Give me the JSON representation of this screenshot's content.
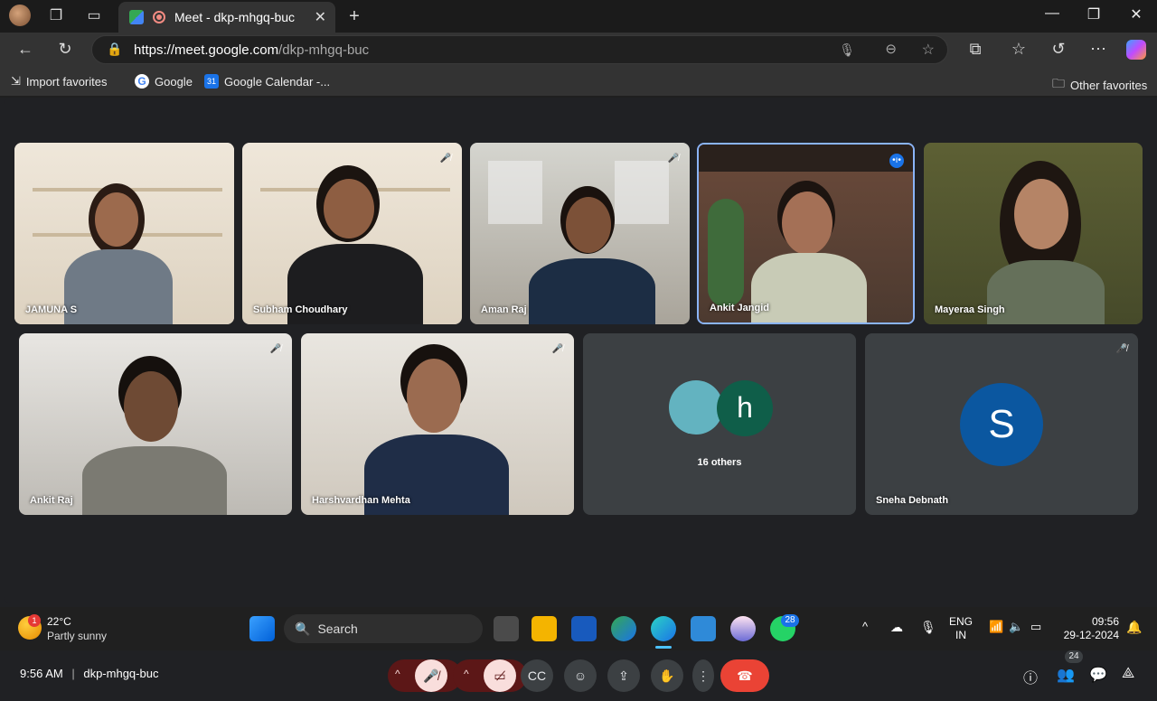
{
  "browser": {
    "tab_title": "Meet - dkp-mhgq-buc",
    "url_host": "https://meet.google.com",
    "url_path": "/dkp-mhgq-buc",
    "favorites": [
      "Import favorites",
      "Google",
      "Google Calendar -..."
    ],
    "other_favorites": "Other favorites"
  },
  "meet": {
    "participants_row1": [
      {
        "name": "JAMUNA S",
        "muted": false
      },
      {
        "name": "Subham Choudhary",
        "muted": true
      },
      {
        "name": "Aman Raj",
        "muted": true
      },
      {
        "name": "Ankit Jangid",
        "muted": false,
        "speaking": true
      },
      {
        "name": "Mayeraa Singh",
        "muted": false
      }
    ],
    "participants_row2": [
      {
        "name": "Ankit Raj",
        "muted": true
      },
      {
        "name": "Harshvardhan Mehta",
        "muted": true
      }
    ],
    "others": {
      "label": "16 others",
      "letter": "h"
    },
    "sneha": {
      "name": "Sneha Debnath",
      "letter": "S"
    },
    "time": "9:56 AM",
    "meeting_code": "dkp-mhgq-buc",
    "people_count": "24"
  },
  "taskbar": {
    "weather_temp": "22°C",
    "weather_desc": "Partly sunny",
    "weather_badge": "1",
    "search_label": "Search",
    "whatsapp_badge": "28",
    "lang1": "ENG",
    "lang2": "IN",
    "clock_time": "09:56",
    "clock_date": "29-12-2024"
  },
  "colors": {
    "end_call": "#ea4335",
    "muted_red": "#f9dedc",
    "tile_bg": "#3c4043",
    "highlight": "#8ab4f8"
  }
}
